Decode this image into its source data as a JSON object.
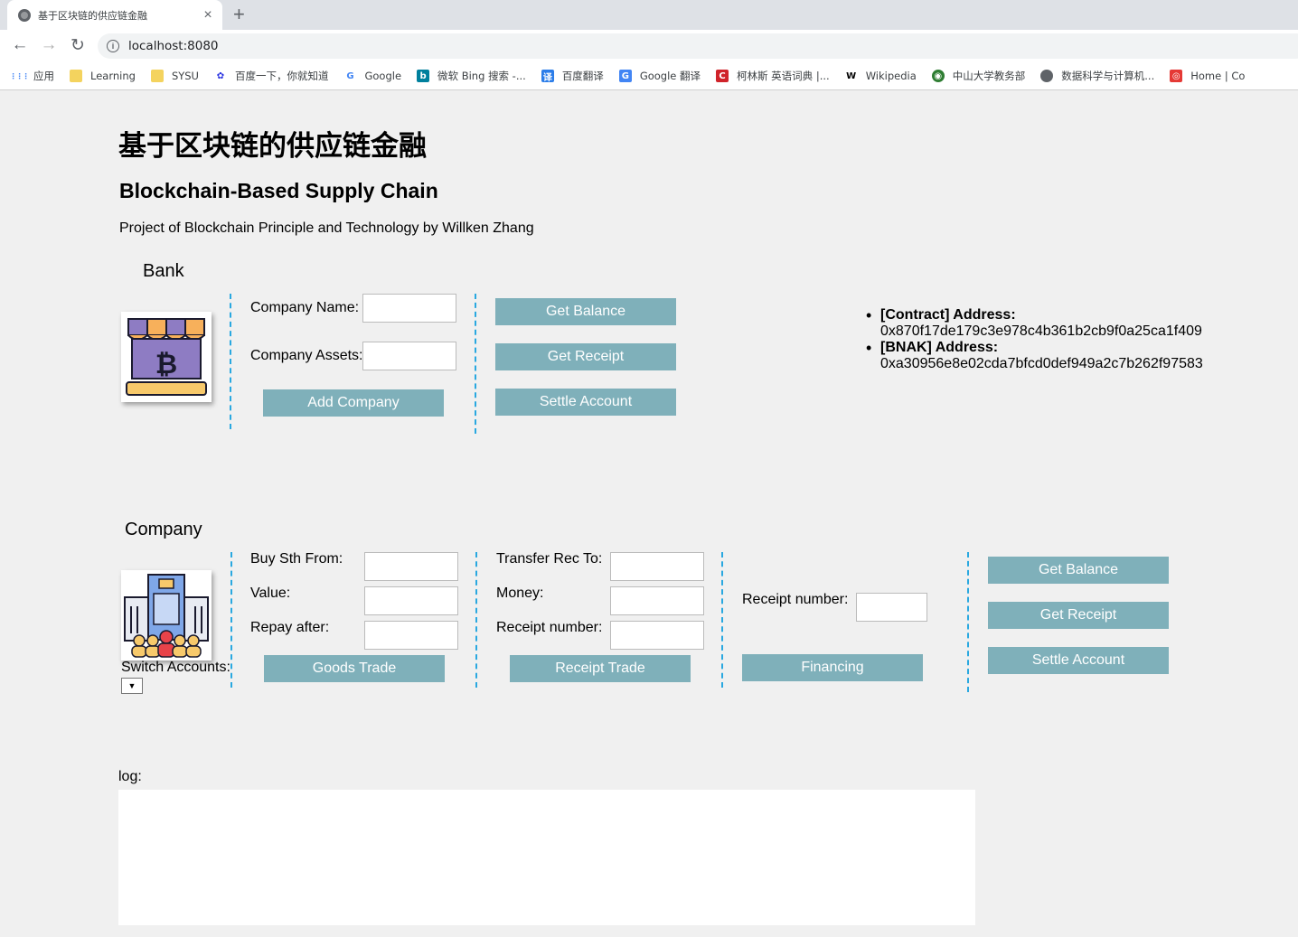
{
  "browser": {
    "tab_title": "基于区块链的供应链金融",
    "tab_close": "×",
    "new_tab": "+",
    "url": "localhost:8080",
    "bookmarks": [
      {
        "label": "应用",
        "icon": "apps-grid-icon"
      },
      {
        "label": "Learning",
        "icon": "folder-icon"
      },
      {
        "label": "SYSU",
        "icon": "folder-icon"
      },
      {
        "label": "百度一下，你就知道",
        "icon": "baidu-icon"
      },
      {
        "label": "Google",
        "icon": "google-icon"
      },
      {
        "label": "微软 Bing 搜索 -...",
        "icon": "bing-icon"
      },
      {
        "label": "百度翻译",
        "icon": "baidu-translate-icon"
      },
      {
        "label": "Google 翻译",
        "icon": "google-translate-icon"
      },
      {
        "label": "柯林斯 英语词典 |...",
        "icon": "collins-icon"
      },
      {
        "label": "Wikipedia",
        "icon": "wikipedia-icon"
      },
      {
        "label": "中山大学教务部",
        "icon": "sysu-icon"
      },
      {
        "label": "数据科学与计算机...",
        "icon": "globe-icon"
      },
      {
        "label": "Home | Co",
        "icon": "home-site-icon"
      }
    ]
  },
  "header": {
    "title": "基于区块链的供应链金融",
    "subtitle": "Blockchain-Based Supply Chain",
    "description": "Project of Blockchain Principle and Technology by Willken Zhang"
  },
  "bank": {
    "label": "Bank",
    "company_name_label": "Company Name:",
    "company_assets_label": "Company Assets:",
    "add_company": "Add Company",
    "get_balance": "Get Balance",
    "get_receipt": "Get Receipt",
    "settle_account": "Settle Account"
  },
  "addresses": [
    {
      "key": "[Contract] Address:",
      "value": "0x870f17de179c3e978c4b361b2cb9f0a25ca1f409"
    },
    {
      "key": "[BNAK] Address:",
      "value": "0xa30956e8e02cda7bfcd0def949a2c7b262f97583"
    }
  ],
  "company": {
    "label": "Company",
    "switch_accounts": "Switch Accounts:",
    "select_arrow": "▼",
    "buy_from_label": "Buy Sth From:",
    "value_label": "Value:",
    "repay_after_label": "Repay after:",
    "goods_trade": "Goods Trade",
    "transfer_to_label": "Transfer Rec To:",
    "money_label": "Money:",
    "receipt_number_label": "Receipt number:",
    "receipt_trade": "Receipt Trade",
    "financing_receipt_label": "Receipt number:",
    "financing": "Financing",
    "get_balance": "Get Balance",
    "get_receipt": "Get Receipt",
    "settle_account": "Settle Account"
  },
  "log": {
    "label": "log:"
  }
}
